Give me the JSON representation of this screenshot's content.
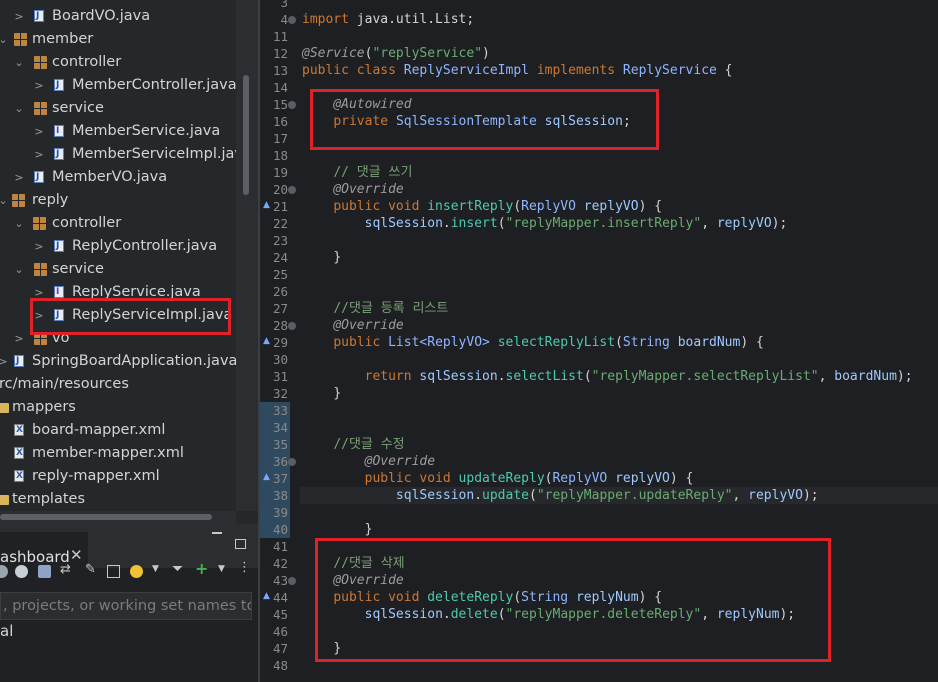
{
  "explorer": {
    "items": [
      {
        "label": "BoardVO.java",
        "icon": "java-file-icon"
      },
      {
        "label": "member",
        "icon": "package-icon"
      },
      {
        "label": "controller",
        "icon": "package-icon"
      },
      {
        "label": "MemberController.java",
        "icon": "java-file-icon"
      },
      {
        "label": "service",
        "icon": "package-icon"
      },
      {
        "label": "MemberService.java",
        "icon": "java-interface-icon"
      },
      {
        "label": "MemberServiceImpl.java",
        "icon": "java-file-icon"
      },
      {
        "label": "MemberVO.java",
        "icon": "java-file-icon"
      },
      {
        "label": "reply",
        "icon": "package-icon"
      },
      {
        "label": "controller",
        "icon": "package-icon"
      },
      {
        "label": "ReplyController.java",
        "icon": "java-file-icon"
      },
      {
        "label": "service",
        "icon": "package-icon"
      },
      {
        "label": "ReplyService.java",
        "icon": "java-interface-icon"
      },
      {
        "label": "ReplyServiceImpl.java",
        "icon": "java-file-icon"
      },
      {
        "label": "vo",
        "icon": "package-icon"
      },
      {
        "label": "SpringBoardApplication.java",
        "icon": "java-file-icon"
      },
      {
        "label": "rc/main/resources",
        "icon": "folder-icon"
      },
      {
        "label": "mappers",
        "icon": "folder-icon"
      },
      {
        "label": "board-mapper.xml",
        "icon": "xml-file-icon"
      },
      {
        "label": "member-mapper.xml",
        "icon": "xml-file-icon"
      },
      {
        "label": "reply-mapper.xml",
        "icon": "xml-file-icon"
      },
      {
        "label": "templates",
        "icon": "folder-icon"
      }
    ]
  },
  "dashboard": {
    "tab_label": "ashboard",
    "close_glyph": "✕",
    "filter_placeholder": ", projects, or working set names to m",
    "local_label": "al"
  },
  "editor": {
    "line_numbers": [
      "3",
      "4",
      "11",
      "12",
      "13",
      "14",
      "15",
      "16",
      "17",
      "18",
      "19",
      "20",
      "21",
      "22",
      "23",
      "24",
      "25",
      "26",
      "27",
      "28",
      "29",
      "30",
      "31",
      "32",
      "33",
      "34",
      "35",
      "36",
      "37",
      "38",
      "39",
      "40",
      "41",
      "42",
      "43",
      "44",
      "45",
      "46",
      "47",
      "48"
    ],
    "lines": {
      "l4_kw": "import",
      "l4_rest": " java.util.List;",
      "l12_ann": "@Service",
      "l12_p1": "(",
      "l12_str": "\"replyService\"",
      "l12_p2": ")",
      "l13_kw": "public class",
      "l13_type": "ReplyServiceImpl",
      "l13_kw2": "implements",
      "l13_type2": "ReplyService",
      "l13_brace": " {",
      "l15_ann": "@Autowired",
      "l16_kw": "private",
      "l16_type": "SqlSessionTemplate",
      "l16_id": "sqlSession",
      "l16_end": ";",
      "l19_cm": "// 댓글 쓰기",
      "l20_ann": "@Override",
      "l21_kw": "public void",
      "l21_m": "insertReply",
      "l21_p": "(",
      "l21_type": "ReplyVO",
      "l21_id": "replyVO",
      "l21_end": ") {",
      "l22_id": "sqlSession",
      "l22_dot": ".",
      "l22_m": "insert",
      "l22_p": "(",
      "l22_str": "\"replyMapper.insertReply\"",
      "l22_c": ", ",
      "l22_arg": "replyVO",
      "l22_end": ");",
      "l24": "}",
      "l27_cm": "//댓글 등록 리스트",
      "l28_ann": "@Override",
      "l29_kw": "public",
      "l29_type": "List<ReplyVO>",
      "l29_m": "selectReplyList",
      "l29_p": "(",
      "l29_type2": "String",
      "l29_id": "boardNum",
      "l29_end": ") {",
      "l31_kw": "return",
      "l31_id": "sqlSession",
      "l31_dot": ".",
      "l31_m": "selectList",
      "l31_p": "(",
      "l31_str": "\"replyMapper.selectReplyList\"",
      "l31_c": ", ",
      "l31_arg": "boardNum",
      "l31_end": ");",
      "l32": "}",
      "l35_cm": "//댓글 수정",
      "l36_ann": "@Override",
      "l37_kw": "public void",
      "l37_m": "updateReply",
      "l37_p": "(",
      "l37_type": "ReplyVO",
      "l37_id": "replyVO",
      "l37_end": ") {",
      "l38_id": "sqlSession",
      "l38_dot": ".",
      "l38_m": "update",
      "l38_p": "(",
      "l38_str": "\"replyMapper.updateReply\"",
      "l38_c": ", ",
      "l38_arg": "replyVO",
      "l38_end": ");",
      "l40": "}",
      "l42_cm": "//댓글 삭제",
      "l43_ann": "@Override",
      "l44_kw": "public void",
      "l44_m": "deleteReply",
      "l44_p": "(",
      "l44_type": "String",
      "l44_id": "replyNum",
      "l44_end": ") {",
      "l45_id": "sqlSession",
      "l45_dot": ".",
      "l45_m": "delete",
      "l45_p": "(",
      "l45_str": "\"replyMapper.deleteReply\"",
      "l45_c": ", ",
      "l45_arg": "replyNum",
      "l45_end": ");",
      "l47": "}"
    }
  },
  "colors": {
    "highlight_box": "#e02127",
    "editor_bg": "#1e1f22",
    "explorer_bg": "#25282b"
  }
}
